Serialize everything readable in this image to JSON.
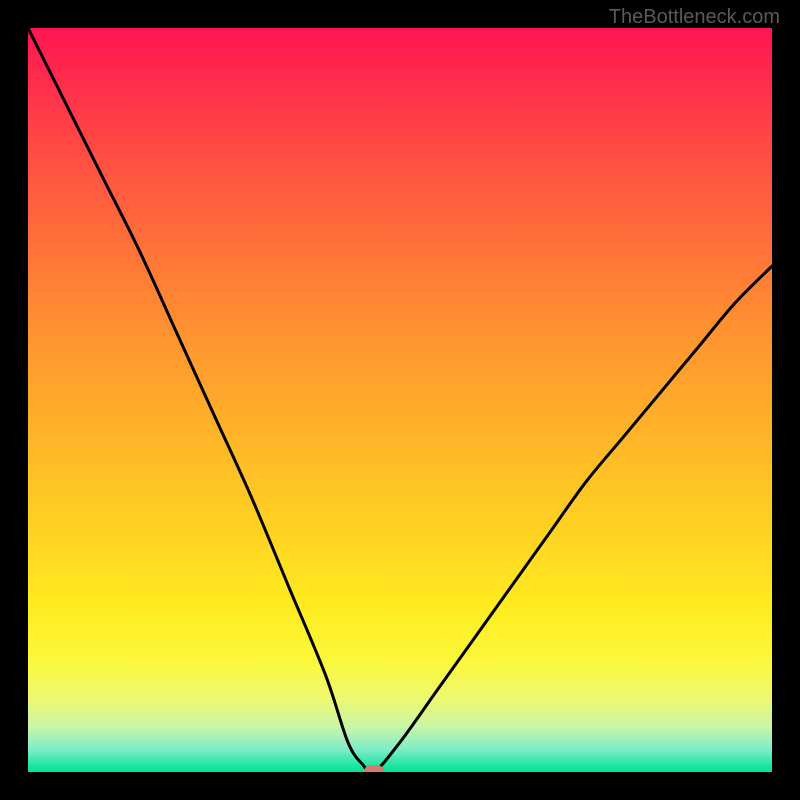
{
  "watermark": "TheBottleneck.com",
  "chart_data": {
    "type": "line",
    "title": "",
    "xlabel": "",
    "ylabel": "",
    "xlim": [
      0,
      100
    ],
    "ylim": [
      0,
      100
    ],
    "series": [
      {
        "name": "curve",
        "x": [
          0,
          5,
          10,
          15,
          20,
          25,
          30,
          35,
          40,
          43,
          45,
          46.5,
          50,
          55,
          60,
          65,
          70,
          75,
          80,
          85,
          90,
          95,
          100
        ],
        "values": [
          100,
          90,
          80,
          70,
          59,
          48,
          37,
          25,
          13,
          4,
          1,
          0,
          4,
          11,
          18,
          25,
          32,
          39,
          45,
          51,
          57,
          63,
          68
        ]
      }
    ],
    "marker": {
      "x": 46.5,
      "y": 0
    },
    "background_gradient": {
      "top": "#ff1452",
      "mid_upper": "#ff9530",
      "mid_lower": "#ffec20",
      "bottom": "#00e28f"
    }
  }
}
